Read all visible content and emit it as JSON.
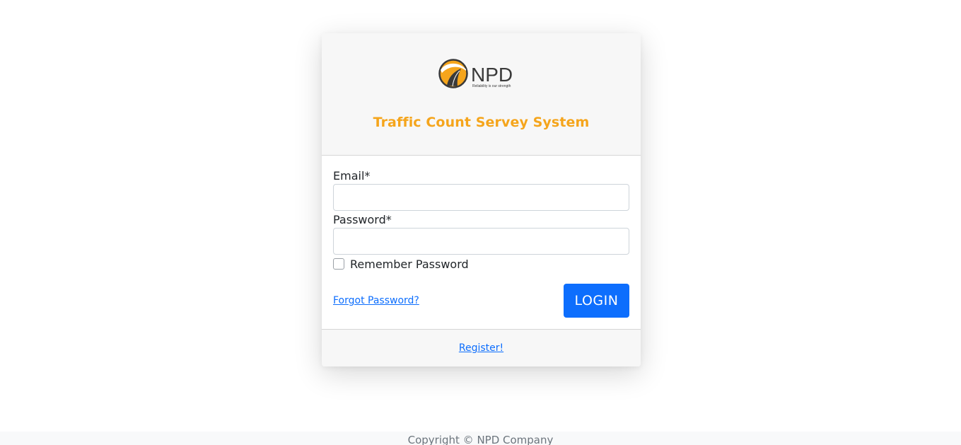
{
  "brand": {
    "logo_text": "NPD",
    "logo_tagline": "Reliability is our strength"
  },
  "header": {
    "title": "Traffic Count Servey System"
  },
  "form": {
    "email_label": "Email*",
    "email_value": "",
    "password_label": "Password*",
    "password_value": "",
    "remember_label": "Remember Password",
    "remember_checked": false,
    "forgot_label": "Forgot Password?",
    "login_label": "LOGIN"
  },
  "card_footer": {
    "register_label": "Register!"
  },
  "page_footer": {
    "copyright": "Copyright © NPD Company"
  },
  "colors": {
    "title": "#f5a51c",
    "primary": "#0d6efd"
  }
}
